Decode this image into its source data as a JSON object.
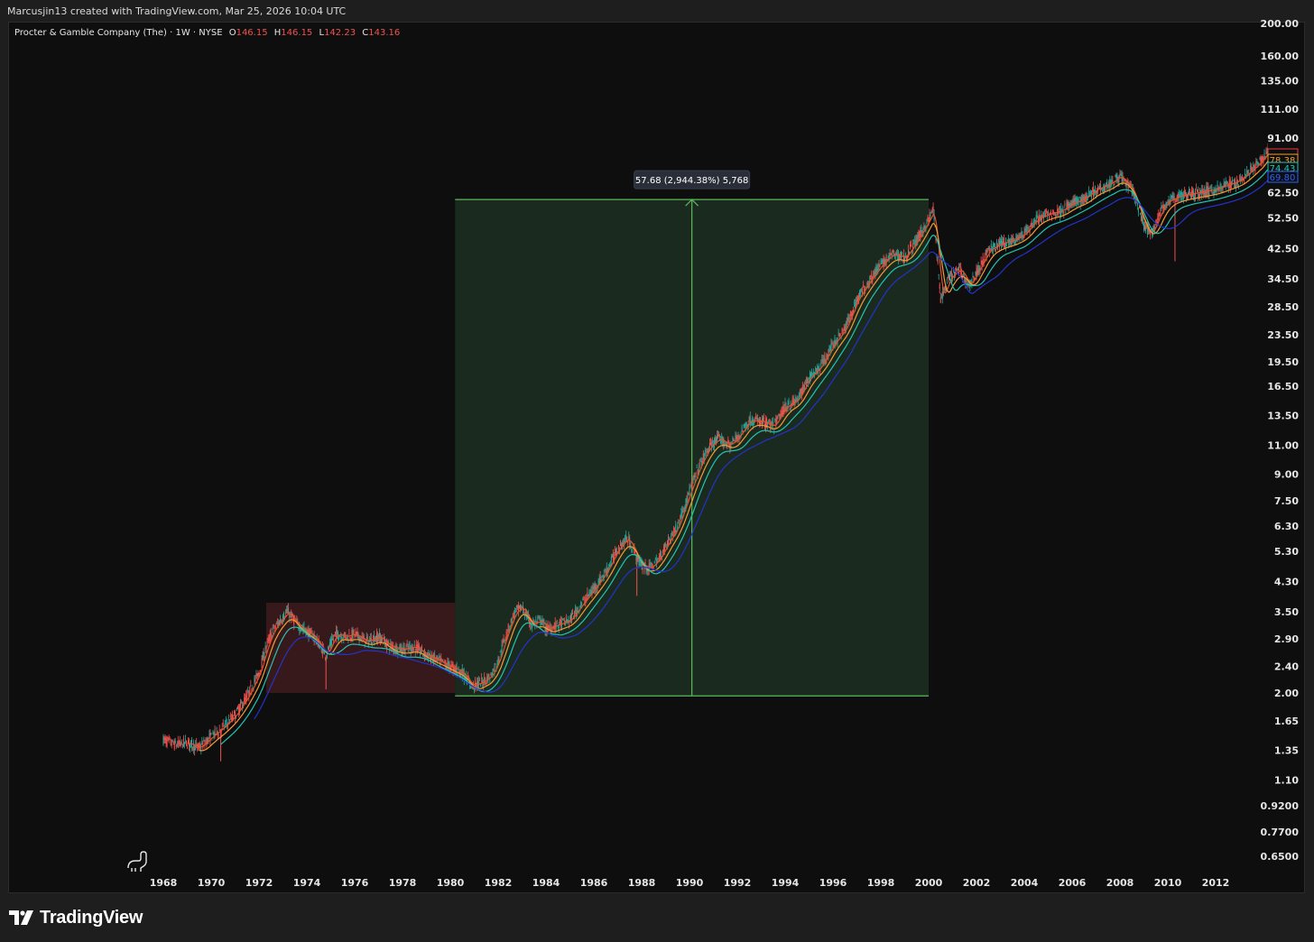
{
  "header": {
    "attribution": "Marcusjin13 created with TradingView.com, Mar 25, 2026 10:04 UTC"
  },
  "legend": {
    "title": "Procter & Gamble Company (The) · 1W · NYSE",
    "open_key": "O",
    "open": "146.15",
    "high_key": "H",
    "high": "146.15",
    "low_key": "L",
    "low": "142.23",
    "close_key": "C",
    "close": "143.16"
  },
  "footer": {
    "brand": "TradingView",
    "logo_icon": "tradingview-logo-icon"
  },
  "colors": {
    "background": "#0e0e0f",
    "up": "#26a69a",
    "down": "#ef5350",
    "ma_fast": "#e3542d",
    "ma_mid": "#f39c34",
    "ma_teal": "#22c4b4",
    "ma_slow": "#2333c9",
    "gain_box": "#1b2a1e",
    "gain_line": "#5cb85c",
    "loss_box": "#3a1a1e"
  },
  "chart_data": {
    "type": "line",
    "scale": "log",
    "title": "",
    "xlabel": "",
    "ylabel": "",
    "x_ticks": [
      "1968",
      "1970",
      "1972",
      "1974",
      "1976",
      "1978",
      "1980",
      "1982",
      "1984",
      "1986",
      "1988",
      "1990",
      "1992",
      "1994",
      "1996",
      "1998",
      "2000",
      "2002",
      "2004",
      "2006",
      "2008",
      "2010",
      "2012"
    ],
    "y_ticks": [
      "200.00",
      "160.00",
      "135.00",
      "111.00",
      "91.00",
      "75.00",
      "62.50",
      "52.50",
      "42.50",
      "34.50",
      "28.50",
      "23.50",
      "19.50",
      "16.50",
      "13.50",
      "11.00",
      "9.00",
      "7.50",
      "6.30",
      "5.30",
      "4.30",
      "3.50",
      "2.90",
      "2.40",
      "2.00",
      "1.65",
      "1.35",
      "1.10",
      "0.9200",
      "0.7700",
      "0.6500"
    ],
    "xlim": [
      1967.0,
      2014.4
    ],
    "price_series": {
      "name": "",
      "x": [
        1968.0,
        1968.5,
        1969.0,
        1969.5,
        1970.0,
        1970.5,
        1971.0,
        1971.5,
        1972.0,
        1972.3,
        1972.6,
        1972.9,
        1973.2,
        1973.6,
        1974.0,
        1974.3,
        1974.8,
        1975.2,
        1975.6,
        1976.0,
        1976.5,
        1977.0,
        1977.5,
        1978.0,
        1978.5,
        1979.0,
        1979.5,
        1980.0,
        1980.5,
        1980.9,
        1981.3,
        1981.7,
        1982.0,
        1982.3,
        1982.7,
        1983.0,
        1983.4,
        1983.8,
        1984.0,
        1984.5,
        1985.0,
        1985.5,
        1986.0,
        1986.5,
        1987.0,
        1987.4,
        1987.7,
        1987.9,
        1988.3,
        1988.7,
        1989.0,
        1989.5,
        1990.0,
        1990.4,
        1990.8,
        1991.2,
        1991.7,
        1992.0,
        1992.5,
        1993.0,
        1993.5,
        1994.0,
        1994.5,
        1995.0,
        1995.5,
        1996.0,
        1996.5,
        1997.0,
        1997.5,
        1998.0,
        1998.5,
        1999.0,
        1999.5,
        2000.0,
        2000.2,
        2000.5,
        2000.9,
        2001.3,
        2001.7,
        2002.0,
        2002.5,
        2003.0,
        2003.5,
        2004.0,
        2004.5,
        2005.0,
        2005.5,
        2006.0,
        2006.5,
        2007.0,
        2007.5,
        2008.0,
        2008.5,
        2009.0,
        2009.3,
        2009.7,
        2010.0,
        2010.5,
        2011.0,
        2011.5,
        2012.0,
        2012.5,
        2013.0,
        2013.5,
        2014.0,
        2014.2
      ],
      "close": [
        1.45,
        1.4,
        1.42,
        1.37,
        1.48,
        1.58,
        1.72,
        1.95,
        2.3,
        2.75,
        3.1,
        3.3,
        3.5,
        3.2,
        3.05,
        2.95,
        2.6,
        3.0,
        2.95,
        3.0,
        2.85,
        2.95,
        2.75,
        2.7,
        2.75,
        2.6,
        2.5,
        2.4,
        2.3,
        2.1,
        2.15,
        2.25,
        2.5,
        2.95,
        3.5,
        3.6,
        3.2,
        3.3,
        3.1,
        3.2,
        3.3,
        3.7,
        4.1,
        4.6,
        5.4,
        5.8,
        5.3,
        4.9,
        4.7,
        5.0,
        5.5,
        6.3,
        8.0,
        9.5,
        10.8,
        11.5,
        11.0,
        11.6,
        13.0,
        13.0,
        12.5,
        14.3,
        15.0,
        17.5,
        19.0,
        22.0,
        24.5,
        30.0,
        34.0,
        38.0,
        41.0,
        40.0,
        45.0,
        52.0,
        56.0,
        30.0,
        35.0,
        37.0,
        33.0,
        36.0,
        42.0,
        44.0,
        45.0,
        47.0,
        52.0,
        54.0,
        55.0,
        58.0,
        60.0,
        64.0,
        66.0,
        70.0,
        64.0,
        50.0,
        47.0,
        55.0,
        59.0,
        61.0,
        62.0,
        63.0,
        64.0,
        66.0,
        68.0,
        73.0,
        79.0,
        85.0
      ]
    },
    "moving_averages": [
      {
        "name": "",
        "color": "ma_fast"
      },
      {
        "name": "",
        "color": "ma_mid"
      },
      {
        "name": "",
        "color": "ma_teal"
      },
      {
        "name": "",
        "color": "ma_slow"
      }
    ],
    "price_labels": [
      {
        "value": "",
        "color": "#f23645"
      },
      {
        "value": "78.38",
        "color": "#f39c34"
      },
      {
        "value": "74.43",
        "color": "#22c4b4"
      },
      {
        "value": "69.80",
        "color": "#2962ff"
      }
    ],
    "annotations": [
      {
        "type": "range-loss",
        "x0": 1972.3,
        "x1": 1980.2,
        "y0": 2.0,
        "y1": 3.72
      },
      {
        "type": "range-gain",
        "x0": 1980.2,
        "x1": 2000.0,
        "y0": 1.96,
        "y1": 59.6,
        "arrow_x": 1990.1,
        "label": "57.68 (2,944.38%) 5,768"
      }
    ]
  }
}
